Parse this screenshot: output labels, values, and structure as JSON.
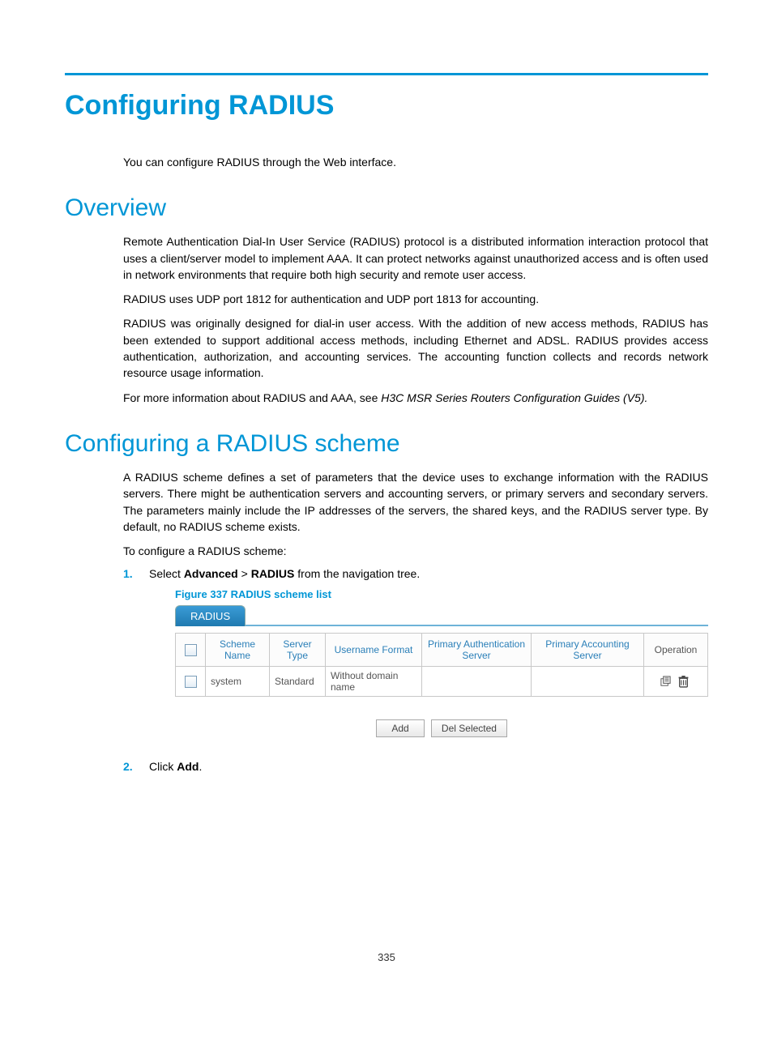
{
  "chapter_title": "Configuring RADIUS",
  "intro_para": "You can configure RADIUS through the Web interface.",
  "overview": {
    "heading": "Overview",
    "p1": "Remote Authentication Dial-In User Service (RADIUS) protocol is a distributed information interaction protocol that uses a client/server model to implement AAA. It can protect networks against unauthorized access and is often used in network environments that require both high security and remote user access.",
    "p2": "RADIUS uses UDP port 1812 for authentication and UDP port 1813 for accounting.",
    "p3": "RADIUS was originally designed for dial-in user access. With the addition of new access methods, RADIUS has been extended to support additional access methods, including Ethernet and ADSL. RADIUS provides access authentication, authorization, and accounting services. The accounting function collects and records network resource usage information.",
    "p4_pre": "For more information about RADIUS and AAA, see ",
    "p4_em": "H3C MSR Series Routers Configuration Guides (V5).",
    "p4_post": ""
  },
  "scheme": {
    "heading": "Configuring a RADIUS scheme",
    "p1": "A RADIUS scheme defines a set of parameters that the device uses to exchange information with the RADIUS servers. There might be authentication servers and accounting servers, or primary servers and secondary servers. The parameters mainly include the IP addresses of the servers, the shared keys, and the RADIUS server type. By default, no RADIUS scheme exists.",
    "p2": "To configure a RADIUS scheme:",
    "step1_pre": "Select ",
    "step1_b1": "Advanced",
    "step1_gt": " > ",
    "step1_b2": "RADIUS",
    "step1_post": " from the navigation tree.",
    "step2_pre": "Click ",
    "step2_b": "Add",
    "step2_post": "."
  },
  "figure": {
    "caption": "Figure 337 RADIUS scheme list",
    "tab_label": "RADIUS",
    "headers": {
      "scheme_name": "Scheme Name",
      "server_type": "Server Type",
      "username_format": "Username Format",
      "primary_auth": "Primary Authentication Server",
      "primary_acct": "Primary Accounting Server",
      "operation": "Operation"
    },
    "row": {
      "scheme_name": "system",
      "server_type": "Standard",
      "username_format": "Without domain name",
      "primary_auth": "",
      "primary_acct": ""
    },
    "buttons": {
      "add": "Add",
      "del": "Del Selected"
    }
  },
  "page_number": "335"
}
